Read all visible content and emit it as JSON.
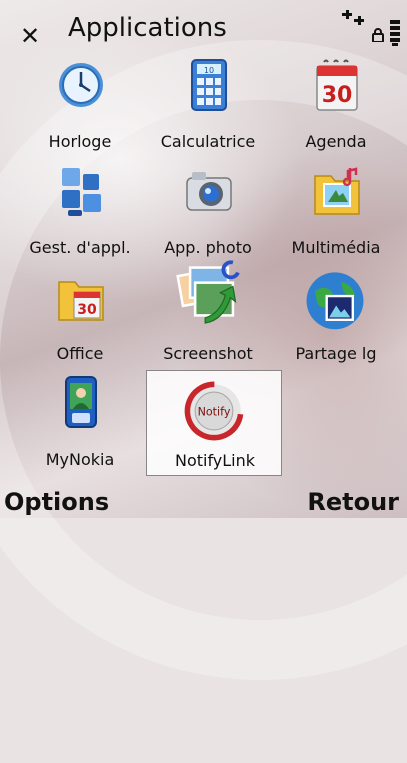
{
  "header": {
    "title": "Applications",
    "close_icon": "close-icon",
    "signal_icon": "signal-icon",
    "battery_icon": "battery-icon"
  },
  "apps": [
    {
      "label": "Horloge",
      "icon": "clock-icon"
    },
    {
      "label": "Calculatrice",
      "icon": "calculator-icon"
    },
    {
      "label": "Agenda",
      "icon": "calendar-icon",
      "icon_text": "30"
    },
    {
      "label": "Gest. d'appl.",
      "icon": "app-manager-icon"
    },
    {
      "label": "App. photo",
      "icon": "camera-icon"
    },
    {
      "label": "Multimédia",
      "icon": "media-folder-icon"
    },
    {
      "label": "Office",
      "icon": "office-folder-icon",
      "icon_text": "30"
    },
    {
      "label": "Screenshot",
      "icon": "screenshot-icon"
    },
    {
      "label": "Partage lg",
      "icon": "globe-share-icon"
    },
    {
      "label": "MyNokia",
      "icon": "nokia-phone-icon"
    },
    {
      "label": "NotifyLink",
      "icon": "notify-icon",
      "icon_text": "Notify",
      "selected": true
    }
  ],
  "softkeys": {
    "left": "Options",
    "right": "Retour"
  },
  "colors": {
    "text": "#111111",
    "selection_background": "#ffffff",
    "notify_red": "#c8262a"
  }
}
